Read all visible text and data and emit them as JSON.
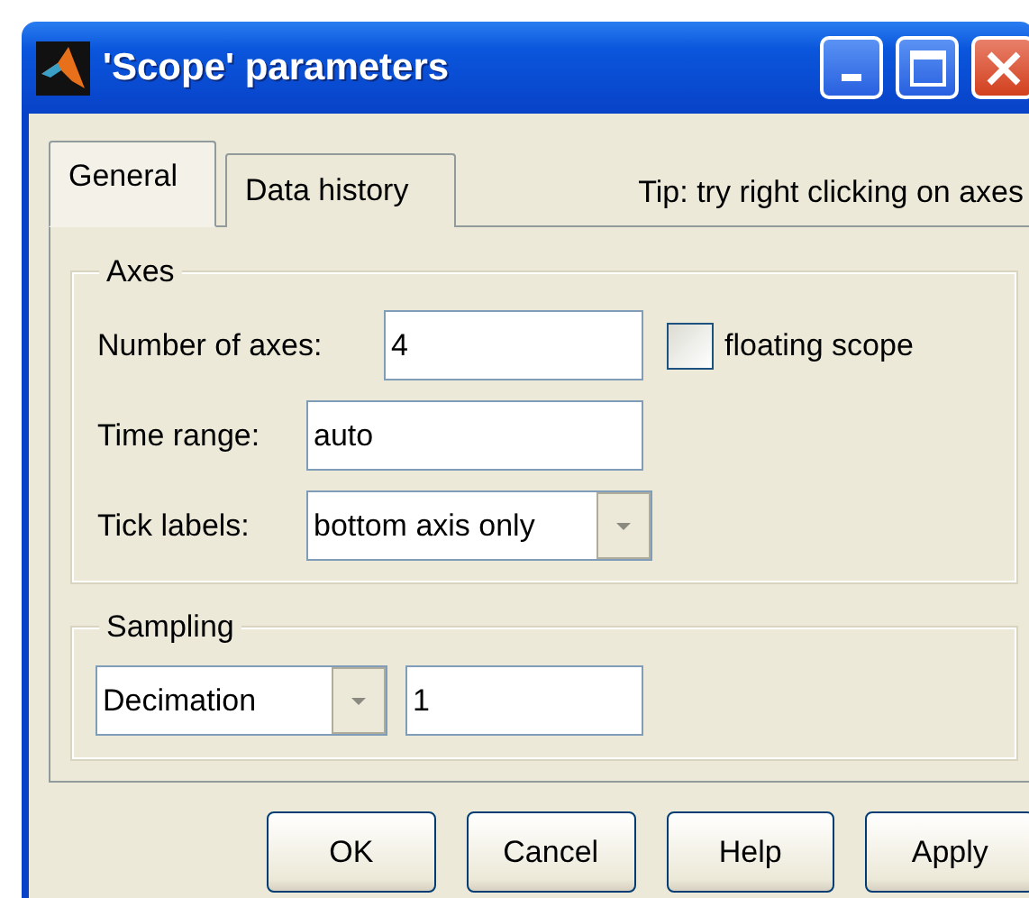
{
  "window": {
    "title": "'Scope' parameters"
  },
  "tabs": [
    {
      "label": "General",
      "selected": true
    },
    {
      "label": "Data history",
      "selected": false
    }
  ],
  "tip": "Tip: try right clicking on axes",
  "axes": {
    "legend": "Axes",
    "number_of_axes": {
      "label": "Number of axes:",
      "value": "4"
    },
    "floating_scope": {
      "label": "floating scope",
      "checked": false
    },
    "time_range": {
      "label": "Time range:",
      "value": "auto"
    },
    "tick_labels": {
      "label": "Tick labels:",
      "value": "bottom axis only"
    }
  },
  "sampling": {
    "legend": "Sampling",
    "mode": "Decimation",
    "value": "1"
  },
  "buttons": [
    "OK",
    "Cancel",
    "Help",
    "Apply"
  ]
}
